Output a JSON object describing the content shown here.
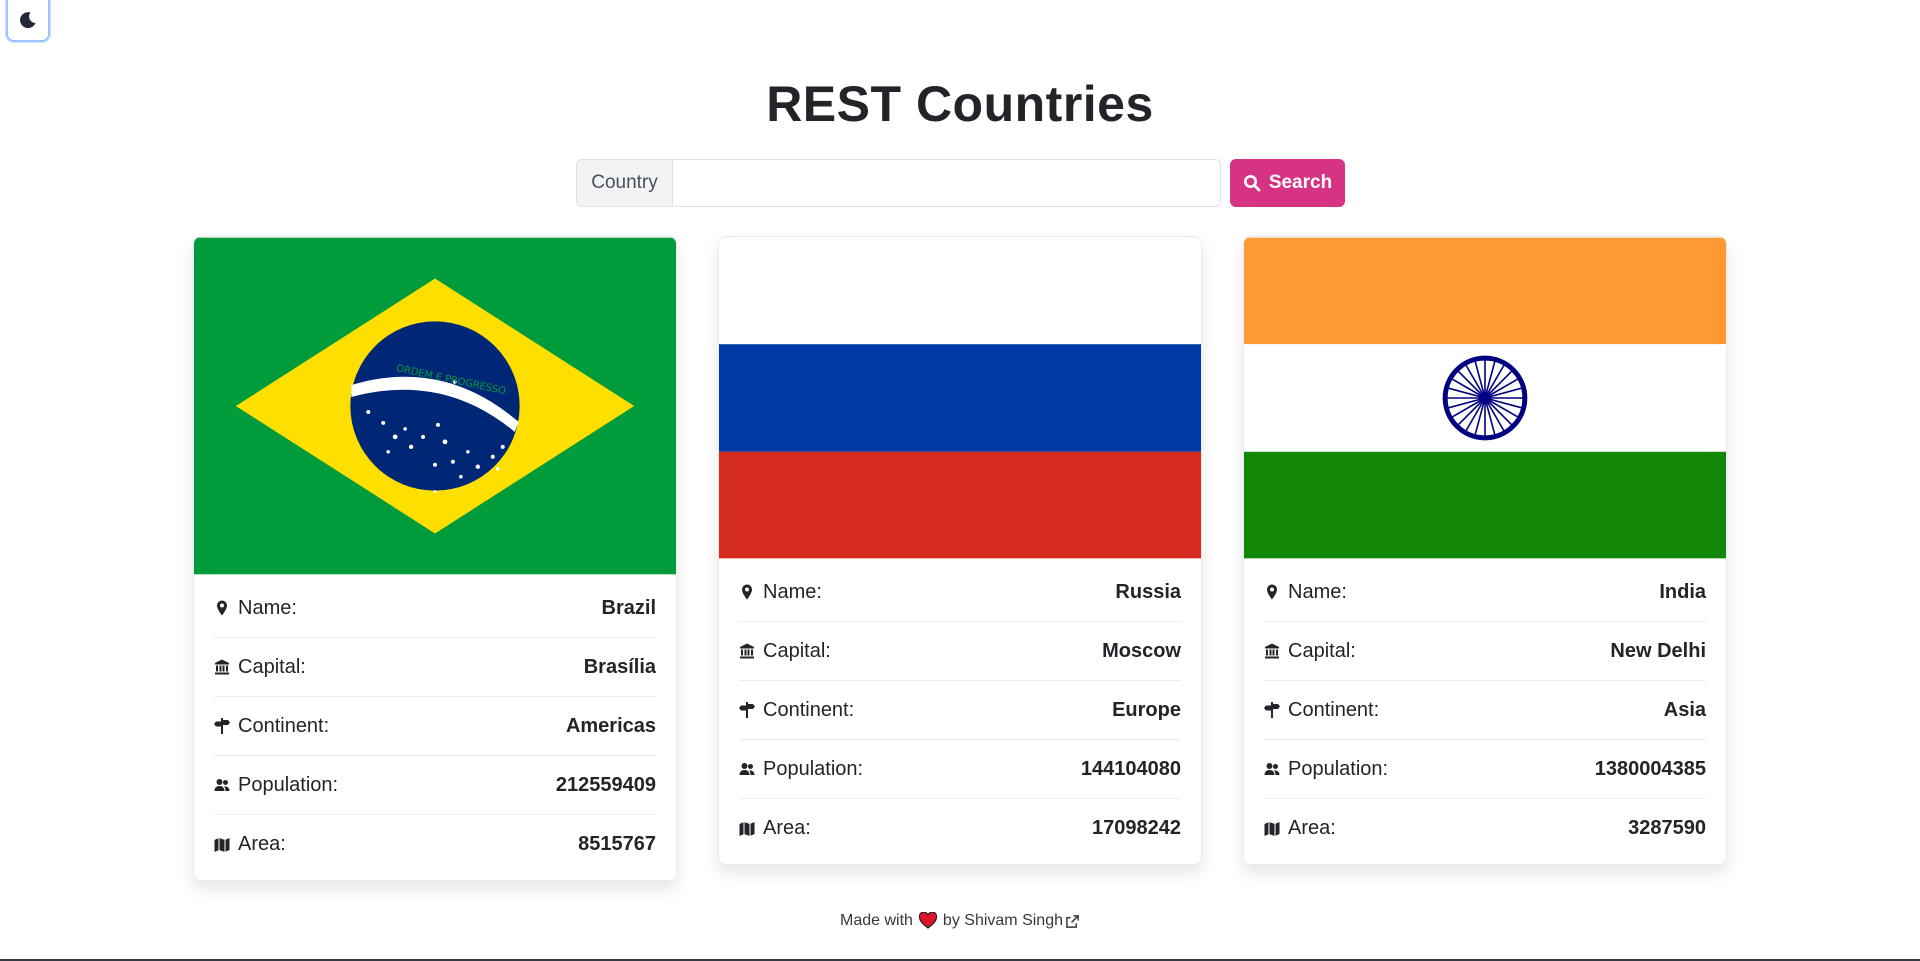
{
  "header": {
    "title": "REST Countries"
  },
  "search": {
    "label": "Country",
    "value": "",
    "placeholder": "",
    "button_label": "Search"
  },
  "field_labels": {
    "name": "Name:",
    "capital": "Capital:",
    "continent": "Continent:",
    "population": "Population:",
    "area": "Area:"
  },
  "countries": [
    {
      "name": "Brazil",
      "capital": "Brasília",
      "continent": "Americas",
      "population": "212559409",
      "area": "8515767",
      "flag_text": "ORDEM E PROGRESSO"
    },
    {
      "name": "Russia",
      "capital": "Moscow",
      "continent": "Europe",
      "population": "144104080",
      "area": "17098242"
    },
    {
      "name": "India",
      "capital": "New Delhi",
      "continent": "Asia",
      "population": "1380004385",
      "area": "3287590"
    }
  ],
  "footer": {
    "made_with": "Made with",
    "by": "by Shivam Singh"
  },
  "colors": {
    "accent": "#d63384",
    "heart": "#e0152a"
  },
  "icons": [
    "moon-icon",
    "search-icon",
    "map-pin-icon",
    "bank-icon",
    "signpost-icon",
    "people-icon",
    "map-icon",
    "heart-icon",
    "external-link-icon"
  ]
}
